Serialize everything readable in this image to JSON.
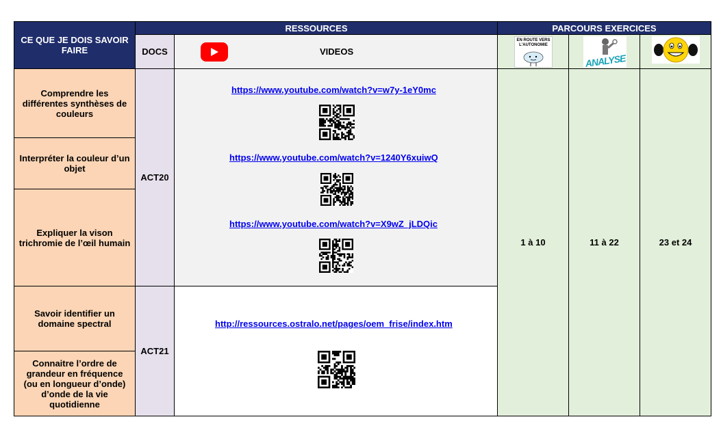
{
  "header": {
    "skills_title": "CE QUE JE DOIS SAVOIR FAIRE",
    "resources_title": "RESSOURCES",
    "exercises_title": "PARCOURS EXERCICES",
    "docs_label": "DOCS",
    "videos_label": "VIDEOS",
    "exercise_logos": [
      {
        "icon": "en-route-vers-autonomie-logo",
        "text": "EN ROUTE VERS L'AUTONOMIE"
      },
      {
        "icon": "analyse-logo",
        "text": "ANALYSE"
      },
      {
        "icon": "strong-smiley-icon",
        "text": ""
      }
    ]
  },
  "skills": [
    "Comprendre les différentes synthèses de couleurs",
    "Interpréter la couleur d’un objet",
    "Expliquer la vison trichromie de l’œil humain",
    "Savoir identifier un domaine spectral",
    "Connaitre l’ordre de grandeur en fréquence (ou en longueur d’onde) d’onde de la vie quotidienne"
  ],
  "docs": [
    "ACT20",
    "ACT21"
  ],
  "links": [
    "https://www.youtube.com/watch?v=w7y-1eY0mc",
    "https://www.youtube.com/watch?v=1240Y6xuiwQ",
    "https://www.youtube.com/watch?v=X9wZ_jLDQic",
    "http://ressources.ostralo.net/pages/oem_frise/index.htm"
  ],
  "exercises": [
    "1 à 10",
    "11 à 22",
    "23 et 24"
  ],
  "colors": {
    "navy": "#1f2d6b",
    "skills_bg": "#fbd5b5",
    "docs_bg": "#e6e0ec",
    "videos_bg": "#f2f2f2",
    "exercises_bg": "#e2efda",
    "link": "#0000ee",
    "youtube_red": "#ff0000"
  }
}
